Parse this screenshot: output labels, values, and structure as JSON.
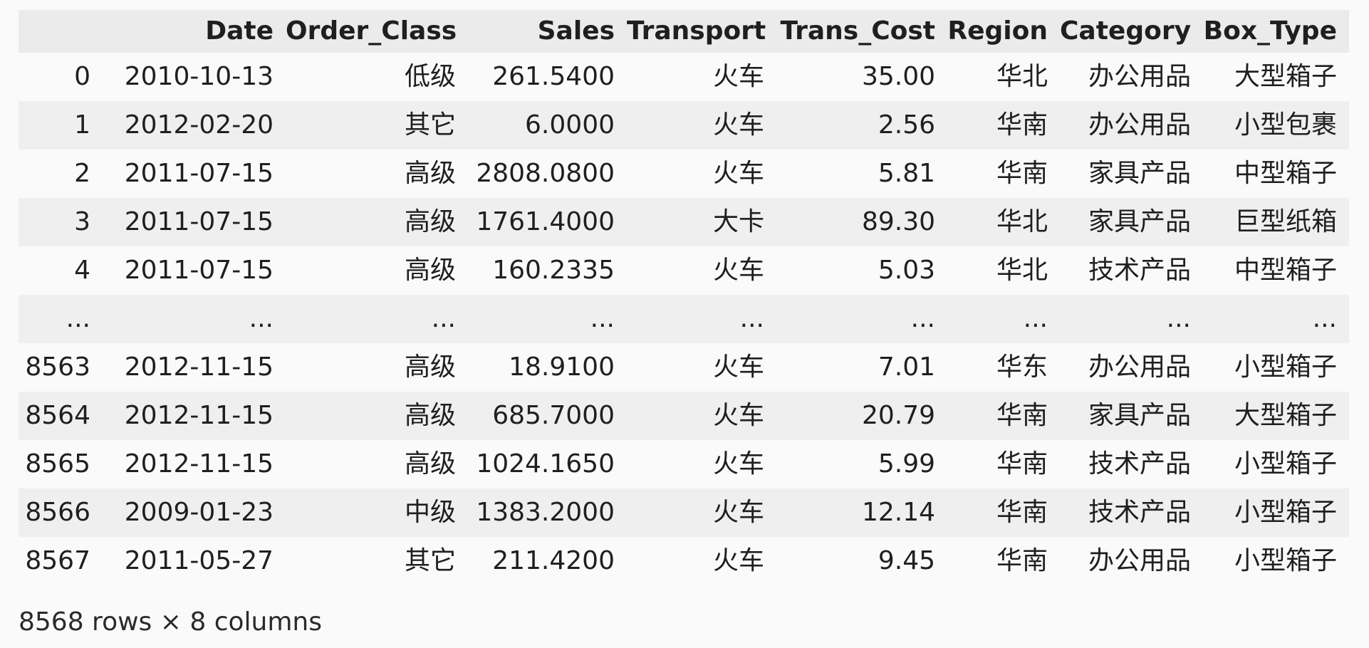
{
  "table": {
    "columns": [
      "",
      "Date",
      "Order_Class",
      "Sales",
      "Transport",
      "Trans_Cost",
      "Region",
      "Category",
      "Box_Type"
    ],
    "rows": [
      [
        "0",
        "2010-10-13",
        "低级",
        "261.5400",
        "火车",
        "35.00",
        "华北",
        "办公用品",
        "大型箱子"
      ],
      [
        "1",
        "2012-02-20",
        "其它",
        "6.0000",
        "火车",
        "2.56",
        "华南",
        "办公用品",
        "小型包裹"
      ],
      [
        "2",
        "2011-07-15",
        "高级",
        "2808.0800",
        "火车",
        "5.81",
        "华南",
        "家具产品",
        "中型箱子"
      ],
      [
        "3",
        "2011-07-15",
        "高级",
        "1761.4000",
        "大卡",
        "89.30",
        "华北",
        "家具产品",
        "巨型纸箱"
      ],
      [
        "4",
        "2011-07-15",
        "高级",
        "160.2335",
        "火车",
        "5.03",
        "华北",
        "技术产品",
        "中型箱子"
      ],
      [
        "...",
        "...",
        "...",
        "...",
        "...",
        "...",
        "...",
        "...",
        "..."
      ],
      [
        "8563",
        "2012-11-15",
        "高级",
        "18.9100",
        "火车",
        "7.01",
        "华东",
        "办公用品",
        "小型箱子"
      ],
      [
        "8564",
        "2012-11-15",
        "高级",
        "685.7000",
        "火车",
        "20.79",
        "华南",
        "家具产品",
        "大型箱子"
      ],
      [
        "8565",
        "2012-11-15",
        "高级",
        "1024.1650",
        "火车",
        "5.99",
        "华南",
        "技术产品",
        "小型箱子"
      ],
      [
        "8566",
        "2009-01-23",
        "中级",
        "1383.2000",
        "火车",
        "12.14",
        "华南",
        "技术产品",
        "小型箱子"
      ],
      [
        "8567",
        "2011-05-27",
        "其它",
        "211.4200",
        "火车",
        "9.45",
        "华南",
        "办公用品",
        "小型箱子"
      ]
    ]
  },
  "shape_note": "8568 rows × 8 columns"
}
